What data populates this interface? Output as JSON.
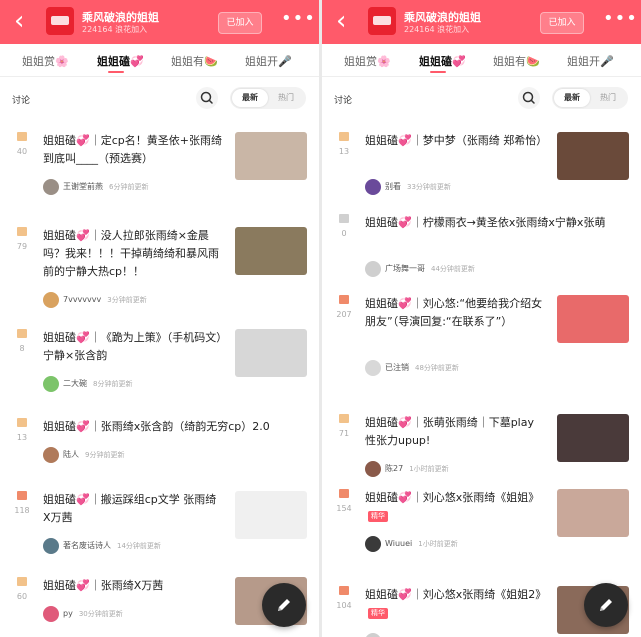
{
  "colors": {
    "brand": "#ff5a6a",
    "accent": "#ff5a6a"
  },
  "panels": [
    {
      "header": {
        "back_icon": "chevron-left-icon",
        "title": "乘风破浪的姐姐",
        "subtitle": "224164 浪花加入",
        "join_label": "已加入",
        "more_icon": "more-icon"
      },
      "tabs": [
        {
          "label": "姐姐赏🌸"
        },
        {
          "label": "姐姐磕💞"
        },
        {
          "label": "姐姐有🍉"
        },
        {
          "label": "姐姐开🎤"
        }
      ],
      "filter": {
        "label": "讨论",
        "options": [
          "最新",
          "热门"
        ],
        "selected": "最新"
      },
      "posts": [
        {
          "title": "姐姐磕💞｜定cp名！黄圣依+张雨绮 到底叫____（预选赛）",
          "count": "40",
          "author": "王谢堂前燕",
          "time": "6分钟前更新",
          "thumb_color": "#c9b6a6",
          "avatar_color": "#9a8f86",
          "marker_color": "#f2c28a"
        },
        {
          "title": "姐姐磕💞｜没人拉郎张雨绮×金晨吗？我来！！！干掉萌绮绮和暴风雨前的宁静大热cp！！",
          "count": "79",
          "author": "7vvvvvvv",
          "time": "3分钟前更新",
          "thumb_color": "#8a7a5e",
          "avatar_color": "#d9a25f",
          "marker_color": "#f2c28a"
        },
        {
          "title": "姐姐磕💞｜《跪为上策》（手机码文）宁静×张含韵",
          "count": "8",
          "author": "二大碗",
          "time": "8分钟前更新",
          "thumb_color": "#d7d7d7",
          "avatar_color": "#7cc46a",
          "marker_color": "#f2c28a"
        },
        {
          "title": "姐姐磕💞｜张雨绮x张含韵（绮韵无穷cp）2.0",
          "count": "13",
          "author": "陆人",
          "time": "9分钟前更新",
          "thumb_color": "",
          "avatar_color": "#b07a5a",
          "marker_color": "#f2c28a"
        },
        {
          "title": "姐姐磕💞｜搬运踩组cp文学 张雨绮X万茜",
          "count": "118",
          "author": "著名废话诗人",
          "time": "14分钟前更新",
          "thumb_color": "#f0f0f0",
          "avatar_color": "#5a7a8a",
          "marker_color": "#f08a6a"
        },
        {
          "title": "姐姐磕💞｜张雨绮X万茜",
          "count": "60",
          "author": "py",
          "time": "30分钟前更新",
          "thumb_color": "#b69a8a",
          "avatar_color": "#e05a7a",
          "marker_color": "#f2c28a"
        }
      ]
    },
    {
      "header": {
        "back_icon": "chevron-left-icon",
        "title": "乘风破浪的姐姐",
        "subtitle": "224164 浪花加入",
        "join_label": "已加入",
        "more_icon": "more-icon"
      },
      "tabs": [
        {
          "label": "姐姐赏🌸"
        },
        {
          "label": "姐姐磕💞"
        },
        {
          "label": "姐姐有🍉"
        },
        {
          "label": "姐姐开🎤"
        }
      ],
      "filter": {
        "label": "讨论",
        "options": [
          "最新",
          "热门"
        ],
        "selected": "最新"
      },
      "posts": [
        {
          "title": "姐姐磕💞｜梦中梦（张雨绮 郑希怡）",
          "count": "13",
          "author": "别看",
          "time": "33分钟前更新",
          "thumb_color": "#6a4a3a",
          "avatar_color": "#6a4a9a",
          "marker_color": "#f2c28a",
          "badge": ""
        },
        {
          "title": "姐姐磕💞｜柠檬雨衣→黄圣依x张雨绮x宁静x张萌",
          "count": "0",
          "author": "广场舞一哥",
          "time": "44分钟前更新",
          "thumb_color": "",
          "avatar_color": "#cfcfcf",
          "marker_color": "#d0d0d0",
          "badge": ""
        },
        {
          "title": "姐姐磕💞｜刘心悠:“他要给我介绍女朋友”（导演回复:“在联系了”）",
          "count": "207",
          "author": "已注销",
          "time": "48分钟前更新",
          "thumb_color": "#e86a6a",
          "avatar_color": "#d8d8d8",
          "marker_color": "#f08a6a",
          "badge": ""
        },
        {
          "title": "姐姐磕💞｜张萌张雨绮｜下墓play 性张力upup!",
          "count": "71",
          "author": "陈27",
          "time": "1小时前更新",
          "thumb_color": "#4a3a3a",
          "avatar_color": "#8a5a4a",
          "marker_color": "#f2c28a",
          "badge": ""
        },
        {
          "title": "姐姐磕💞｜刘心悠x张雨绮《姐姐》",
          "count": "154",
          "author": "Wiuuei",
          "time": "1小时前更新",
          "thumb_color": "#c9a89a",
          "avatar_color": "#3a3a3a",
          "marker_color": "#f08a6a",
          "badge": "精华"
        },
        {
          "title": "姐姐磕💞｜刘心悠x张雨绮《姐姐2》",
          "count": "104",
          "author": "",
          "time": "",
          "thumb_color": "#8a6a5a",
          "avatar_color": "#cfcfcf",
          "marker_color": "#f08a6a",
          "badge": "精华"
        }
      ]
    }
  ],
  "fab_icon": "pencil-icon"
}
